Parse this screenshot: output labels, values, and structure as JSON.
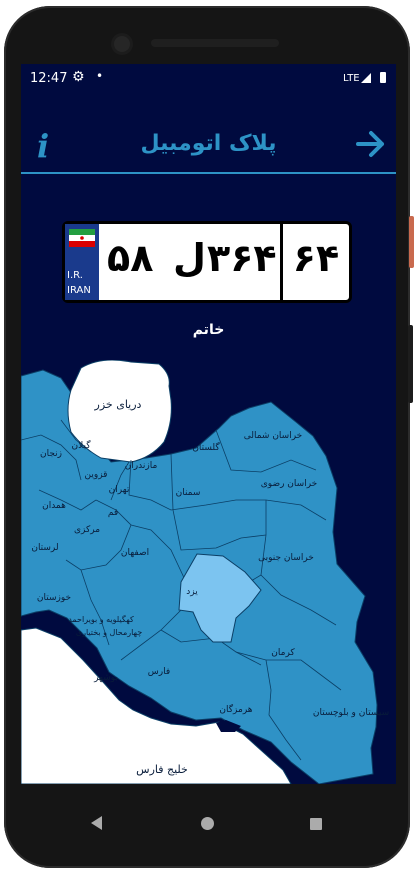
{
  "status_bar": {
    "time": "12:47",
    "network": "LTE",
    "icons": [
      "gear-icon",
      "dot-icon",
      "signal-icon",
      "battery-icon"
    ]
  },
  "app_bar": {
    "title": "پلاک اتومبیل",
    "info_icon": "info-icon",
    "back_icon": "arrow-right-icon"
  },
  "plate": {
    "country_top": "I.R.",
    "country_bottom": "IRAN",
    "left_number": "۵۸",
    "letter": "ل",
    "right_number": "۳۶۴",
    "region_code": "۶۴"
  },
  "city": "خاتم",
  "map": {
    "caspian": "دریای خزر",
    "gulf": "خلیج فارس",
    "selected": "یزد",
    "provinces": [
      "خراسان شمالی",
      "گلستان",
      "مازندران",
      "خراسان رضوی",
      "سمنان",
      "تهران",
      "قزوین",
      "زنجان",
      "گیلان",
      "همدان",
      "مرکزی",
      "قم",
      "لرستان",
      "اصفهان",
      "خراسان جنوبی",
      "خوزستان",
      "کهگیلویه و بویراحمد",
      "بوشهر",
      "فارس",
      "کرمان",
      "هرمزگان",
      "سیستان و بلوچستان",
      "چهارمحال و بختیاری"
    ]
  },
  "colors": {
    "background": "#000a3f",
    "accent": "#2d93c6",
    "map_fill": "#2f92c6",
    "selected_fill": "#7cc4f0"
  },
  "nav": {
    "back": "nav-back-icon",
    "home": "nav-home-icon",
    "recent": "nav-recent-icon"
  }
}
